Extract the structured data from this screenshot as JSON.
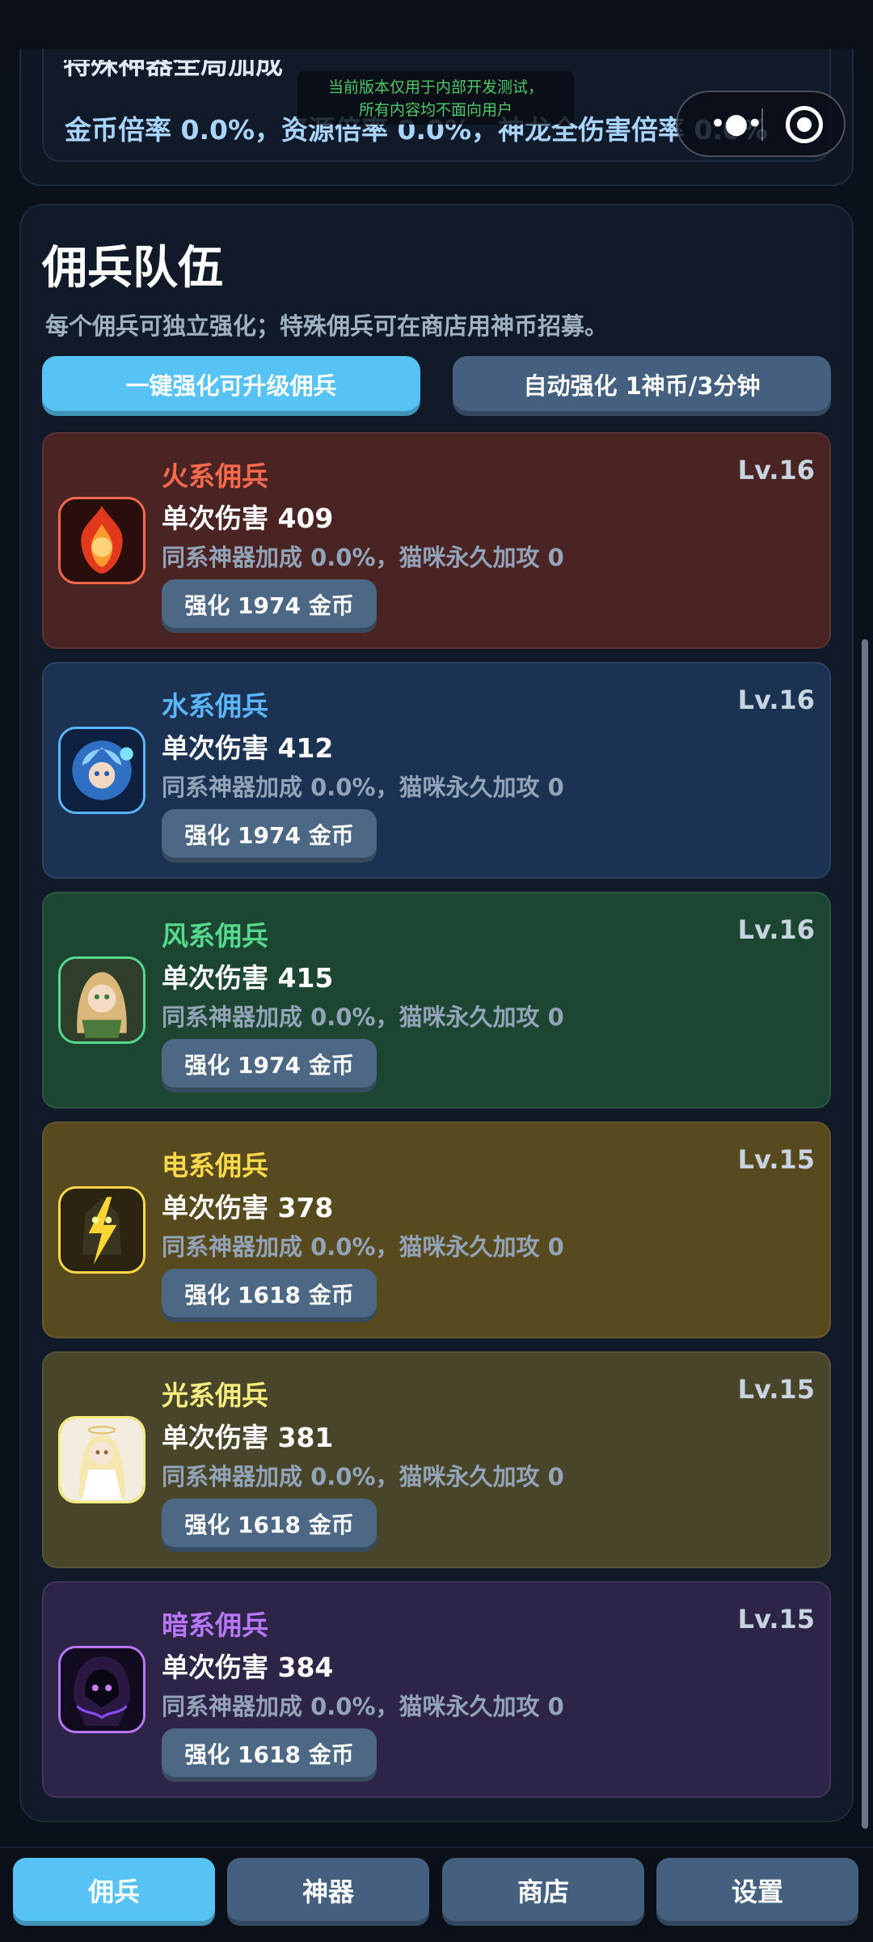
{
  "toast": {
    "line1": "当前版本仅用于内部开发测试，",
    "line2": "所有内容均不面向用户"
  },
  "global_bonus": {
    "title": "特殊神器全局加成",
    "text": "金币倍率 0.0%，资源倍率 0.0%，神龙全伤害倍率 0.0%"
  },
  "team": {
    "title": "佣兵队伍",
    "description": "每个佣兵可独立强化；特殊佣兵可在商店用神币招募。",
    "upgrade_all_label": "一键强化可升级佣兵",
    "auto_upgrade_label": "自动强化 1神币/3分钟"
  },
  "mercenaries": [
    {
      "name": "火系佣兵",
      "level": "Lv.16",
      "damage": "单次伤害 409",
      "bonus": "同系神器加成 0.0%，猫咪永久加攻 0",
      "upgrade_label": "强化 1974 金币",
      "accent": "#ff6a4f",
      "avatar_icon": "fire-mercenary-icon"
    },
    {
      "name": "水系佣兵",
      "level": "Lv.16",
      "damage": "单次伤害 412",
      "bonus": "同系神器加成 0.0%，猫咪永久加攻 0",
      "upgrade_label": "强化 1974 金币",
      "accent": "#5bb6ff",
      "avatar_icon": "water-mercenary-icon"
    },
    {
      "name": "风系佣兵",
      "level": "Lv.16",
      "damage": "单次伤害 415",
      "bonus": "同系神器加成 0.0%，猫咪永久加攻 0",
      "upgrade_label": "强化 1974 金币",
      "accent": "#55d98d",
      "avatar_icon": "wind-mercenary-icon"
    },
    {
      "name": "电系佣兵",
      "level": "Lv.15",
      "damage": "单次伤害 378",
      "bonus": "同系神器加成 0.0%，猫咪永久加攻 0",
      "upgrade_label": "强化 1618 金币",
      "accent": "#ffd84b",
      "avatar_icon": "electric-mercenary-icon"
    },
    {
      "name": "光系佣兵",
      "level": "Lv.15",
      "damage": "单次伤害 381",
      "bonus": "同系神器加成 0.0%，猫咪永久加攻 0",
      "upgrade_label": "强化 1618 金币",
      "accent": "#f7ec80",
      "avatar_icon": "light-mercenary-icon"
    },
    {
      "name": "暗系佣兵",
      "level": "Lv.15",
      "damage": "单次伤害 384",
      "bonus": "同系神器加成 0.0%，猫咪永久加攻 0",
      "upgrade_label": "强化 1618 金币",
      "accent": "#b777ff",
      "avatar_icon": "dark-mercenary-icon"
    }
  ],
  "nav": {
    "tabs": [
      {
        "label": "佣兵",
        "active": true
      },
      {
        "label": "神器",
        "active": false
      },
      {
        "label": "商店",
        "active": false
      },
      {
        "label": "设置",
        "active": false
      }
    ]
  },
  "capsule": {
    "menu_icon": "more-dots-icon",
    "close_icon": "target-circle-icon"
  }
}
